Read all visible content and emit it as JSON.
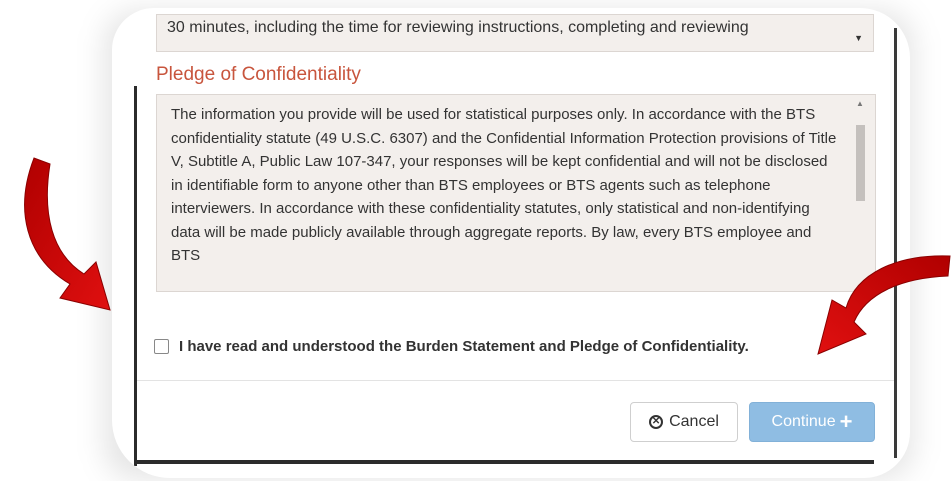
{
  "burden": {
    "partial_text": "30 minutes, including the time for reviewing instructions, completing and reviewing"
  },
  "pledge": {
    "heading": "Pledge of Confidentiality",
    "body": "The information you provide will be used for statistical purposes only. In accordance with the BTS confidentiality statute (49 U.S.C. 6307) and the Confidential Information Protection provisions of Title V, Subtitle A, Public Law 107-347, your responses will be kept confidential and will not be disclosed in identifiable form to anyone other than BTS employees or BTS agents such as telephone interviewers. In accordance with these confidentiality statutes, only statistical and non-identifying data will be made publicly available through aggregate reports. By law, every BTS employee and BTS"
  },
  "agreement": {
    "label": "I have read and understood the Burden Statement and Pledge of Confidentiality.",
    "checked": false
  },
  "footer": {
    "cancel_label": "Cancel",
    "continue_label": "Continue"
  },
  "colors": {
    "heading": "#c8553d",
    "continue_button": "#8fbde3",
    "arrow": "#c00000",
    "panel_bg": "#f3efec"
  },
  "icons": {
    "cancel": "circle-x-icon",
    "continue": "plus-icon",
    "annotation": "red-curved-arrow"
  }
}
